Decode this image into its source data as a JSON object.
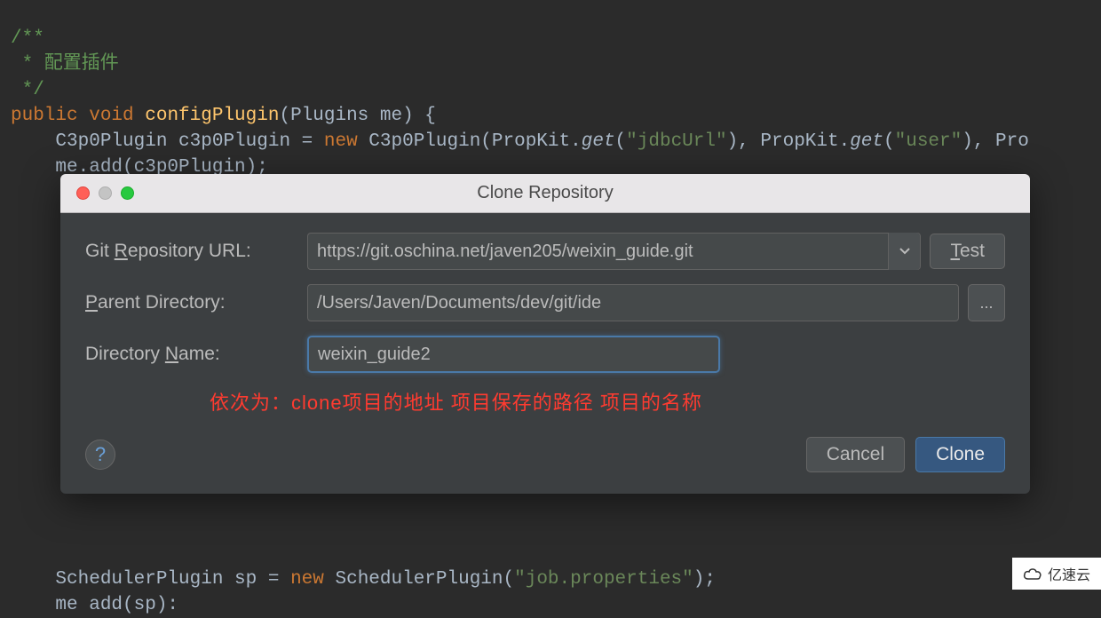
{
  "code": {
    "line1a": "/**",
    "line2a": " * 配置插件",
    "line3a": " */",
    "l4_public": "public ",
    "l4_void": "void ",
    "l4_fn": "configPlugin",
    "l4_rest": "(Plugins me) {",
    "l5_a": "    C3p0Plugin c3p0Plugin = ",
    "l5_new": "new ",
    "l5_b": "C3p0Plugin(PropKit.",
    "l5_get1": "get",
    "l5_c": "(",
    "l5_s1": "\"jdbcUrl\"",
    "l5_d": "), PropKit.",
    "l5_get2": "get",
    "l5_e": "(",
    "l5_s2": "\"user\"",
    "l5_f": "), Pro",
    "l6_a": "    me.add(c3p0Plugin);",
    "l_bottom_a": "    SchedulerPlugin sp = ",
    "l_bottom_new": "new ",
    "l_bottom_b": "SchedulerPlugin(",
    "l_bottom_s": "\"job.properties\"",
    "l_bottom_c": ");",
    "l_last": "    me add(sp):"
  },
  "dialog": {
    "title": "Clone Repository",
    "url_label_pre": "Git ",
    "url_label_u": "R",
    "url_label_post": "epository URL:",
    "url_value": "https://git.oschina.net/javen205/weixin_guide.git",
    "test_u": "T",
    "test_rest": "est",
    "parent_label_u": "P",
    "parent_label_rest": "arent Directory:",
    "parent_value": "/Users/Javen/Documents/dev/git/ide",
    "dir_label_pre": "Directory ",
    "dir_label_u": "N",
    "dir_label_post": "ame:",
    "dir_value": "weixin_guide2",
    "annotation": "依次为：clone项目的地址  项目保存的路径  项目的名称",
    "help": "?",
    "cancel": "Cancel",
    "clone": "Clone",
    "browse": "..."
  },
  "watermark": {
    "text": "亿速云"
  }
}
